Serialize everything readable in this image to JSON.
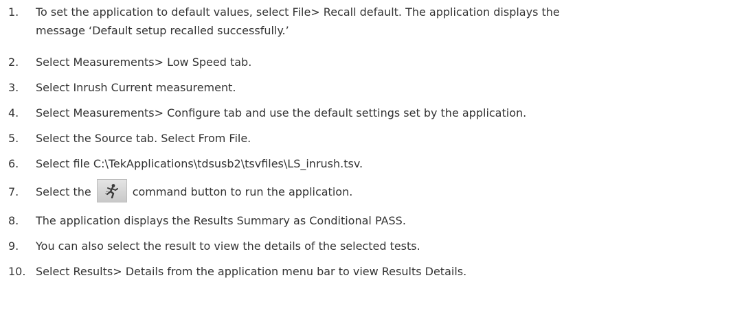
{
  "steps": [
    {
      "number": "1.",
      "text": "To set the application to default values, select File> Recall default. The application displays the",
      "text_cont": "message ‘Default setup recalled successfully.’"
    },
    {
      "number": "2.",
      "text": "Select Measurements> Low Speed tab."
    },
    {
      "number": "3.",
      "text": "Select Inrush Current measurement."
    },
    {
      "number": "4.",
      "text": "Select Measurements> Configure tab and use the default settings set by the application."
    },
    {
      "number": "5.",
      "text": "Select the Source tab. Select From File."
    },
    {
      "number": "6.",
      "text": "Select file C:\\TekApplications\\tdsusb2\\tsvfiles\\LS_inrush.tsv."
    },
    {
      "number": "7.",
      "text_before": "Select the",
      "icon": "run-application-icon",
      "text_after": "command button to run the application."
    },
    {
      "number": "8.",
      "text": "The application displays the Results Summary as Conditional PASS."
    },
    {
      "number": "9.",
      "text": "You can also select the result to view the details of the selected tests."
    },
    {
      "number": "10.",
      "text": "Select Results> Details from the application menu bar to view Results Details."
    }
  ],
  "colors": {
    "text": "#333333",
    "button_face": "#d6d6d6"
  }
}
